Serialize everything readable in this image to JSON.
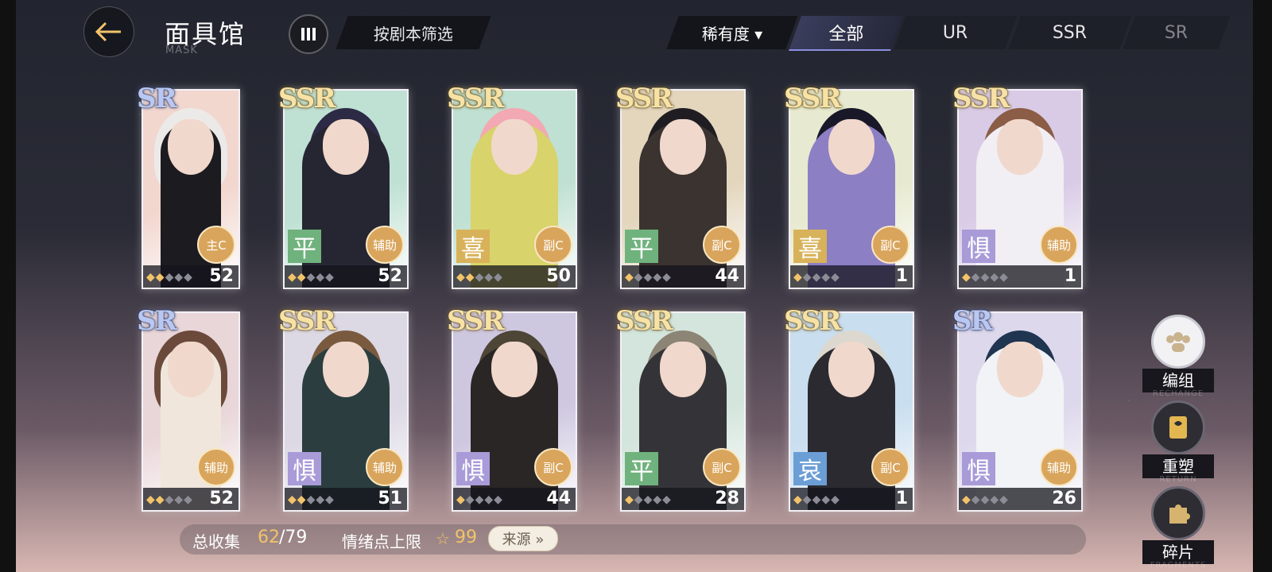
{
  "header": {
    "title": "面具馆",
    "subtitle": "MASK",
    "filter_label": "按剧本筛选",
    "sort_label": "稀有度",
    "tabs": [
      "全部",
      "UR",
      "SSR",
      "SR"
    ]
  },
  "cards": [
    {
      "rank": "SR",
      "emotion": "",
      "role": "主C",
      "level": "52",
      "stars": 2,
      "colors": [
        "#f2d7cf",
        "#eceae8",
        "#1c1b20"
      ]
    },
    {
      "rank": "SSR",
      "emotion": "平",
      "role": "辅助",
      "level": "52",
      "stars": 2,
      "colors": [
        "#bfe1d4",
        "#2d2a45",
        "#262632"
      ]
    },
    {
      "rank": "SSR",
      "emotion": "喜",
      "role": "副C",
      "level": "50",
      "stars": 2,
      "colors": [
        "#bfe0d2",
        "#f2a9b3",
        "#d8d36a"
      ]
    },
    {
      "rank": "SSR",
      "emotion": "平",
      "role": "副C",
      "level": "44",
      "stars": 1,
      "colors": [
        "#e3d6bd",
        "#1f1d22",
        "#3a3330"
      ]
    },
    {
      "rank": "SSR",
      "emotion": "喜",
      "role": "副C",
      "level": "1",
      "stars": 1,
      "colors": [
        "#e7ead0",
        "#191828",
        "#8c7fc4"
      ]
    },
    {
      "rank": "SSR",
      "emotion": "惧",
      "role": "辅助",
      "level": "1",
      "stars": 1,
      "colors": [
        "#d9cbe6",
        "#8b5d46",
        "#f1eef4"
      ]
    },
    {
      "rank": "SR",
      "emotion": "",
      "role": "辅助",
      "level": "52",
      "stars": 2,
      "colors": [
        "#e9d6d8",
        "#6b4a3c",
        "#f0e6dc"
      ]
    },
    {
      "rank": "SSR",
      "emotion": "惧",
      "role": "辅助",
      "level": "51",
      "stars": 2,
      "colors": [
        "#dcd8e4",
        "#7a5a3e",
        "#2b3d3e"
      ]
    },
    {
      "rank": "SSR",
      "emotion": "惧",
      "role": "副C",
      "level": "44",
      "stars": 1,
      "colors": [
        "#cec7e0",
        "#4d4536",
        "#2a2626"
      ]
    },
    {
      "rank": "SSR",
      "emotion": "平",
      "role": "副C",
      "level": "28",
      "stars": 1,
      "colors": [
        "#d3e5dc",
        "#8c8475",
        "#343438"
      ]
    },
    {
      "rank": "SSR",
      "emotion": "哀",
      "role": "副C",
      "level": "1",
      "stars": 1,
      "colors": [
        "#c9deef",
        "#dcd8d0",
        "#2b2a30"
      ]
    },
    {
      "rank": "SR",
      "emotion": "惧",
      "role": "辅助",
      "level": "26",
      "stars": 1,
      "colors": [
        "#ddd8ec",
        "#1f3550",
        "#f1f3f6"
      ]
    }
  ],
  "footer": {
    "collection_label": "总收集",
    "collection_current": "62",
    "collection_total": "/79",
    "emotion_cap_label": "情绪点上限",
    "emotion_cap_value": "99",
    "source_label": "来源 »"
  },
  "side": {
    "group_label": "编组",
    "group_sub": "RECHANGE",
    "reshape_label": "重塑",
    "reshape_sub": "RETURN",
    "fragment_label": "碎片",
    "fragment_sub": "FRAGMENTS"
  }
}
